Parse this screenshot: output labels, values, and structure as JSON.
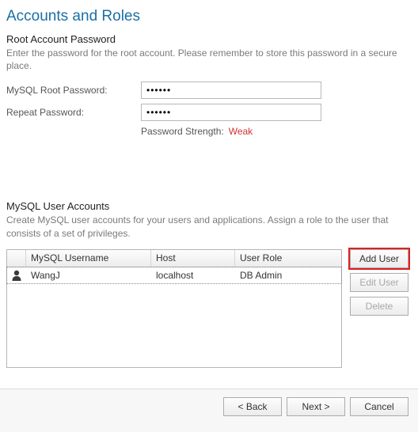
{
  "title": "Accounts and Roles",
  "root_section": {
    "heading": "Root Account Password",
    "description": "Enter the password for the root account.  Please remember to store this password in a secure place.",
    "root_pw_label": "MySQL Root Password:",
    "root_pw_value": "••••••",
    "repeat_pw_label": "Repeat Password:",
    "repeat_pw_value": "••••••",
    "strength_label": "Password Strength:",
    "strength_value": "Weak"
  },
  "users_section": {
    "heading": "MySQL User Accounts",
    "description": "Create MySQL user accounts for your users and applications. Assign a role to the user that consists of a set of privileges.",
    "columns": {
      "username": "MySQL Username",
      "host": "Host",
      "role": "User Role"
    },
    "rows": [
      {
        "username": "WangJ",
        "host": "localhost",
        "role": "DB Admin"
      }
    ],
    "buttons": {
      "add": "Add User",
      "edit": "Edit User",
      "delete": "Delete"
    }
  },
  "footer": {
    "back": "< Back",
    "next": "Next >",
    "cancel": "Cancel"
  }
}
